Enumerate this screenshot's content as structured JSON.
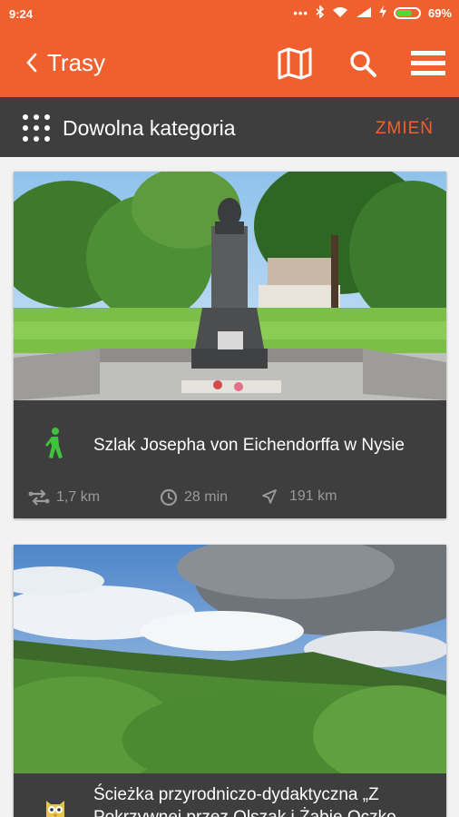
{
  "status_bar": {
    "time": "9:24",
    "battery": "69%",
    "battery_level": 0.69
  },
  "app_bar": {
    "back_label": "Trasy"
  },
  "category_bar": {
    "label": "Dowolna kategoria",
    "change_label": "ZMIEŃ"
  },
  "cards": [
    {
      "title": "Szlak Josepha von Eichendorffa w Nysie",
      "distance": "1,7 km",
      "duration": "28 min",
      "away": "191 km",
      "type_icon": "walking-person-icon"
    },
    {
      "title": "Ścieżka przyrodniczo-dydaktyczna „Z Pokrzywnej przez Olszak i Żabie Oczko",
      "type_icon": "owl-icon"
    }
  ],
  "colors": {
    "accent": "#f0602f",
    "dark": "#3e3e3e",
    "walk_green": "#3ec43a"
  }
}
